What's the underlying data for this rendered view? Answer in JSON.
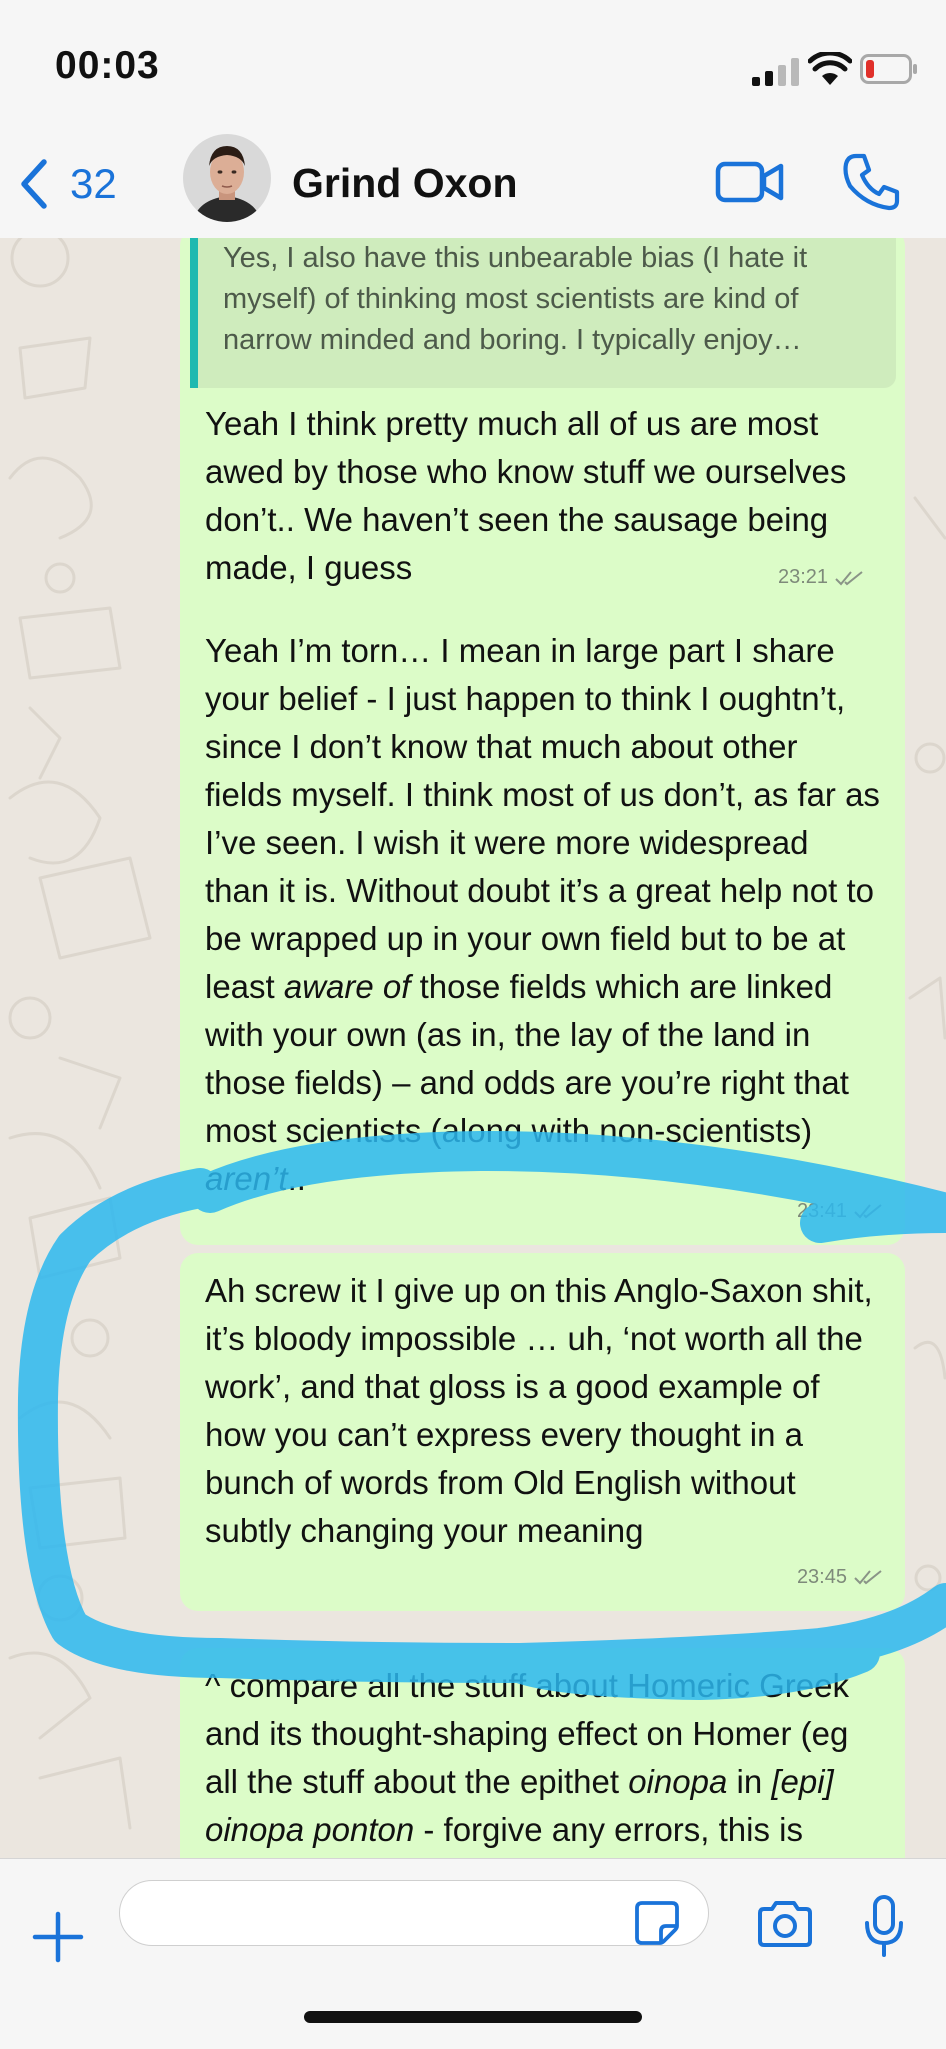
{
  "status_bar": {
    "time": "00:03"
  },
  "header": {
    "back_count": "32",
    "contact_name": "Grind Oxon"
  },
  "messages": [
    {
      "quote": "Yes, I also have this unbearable bias (I hate it myself) of thinking most scientists are kind of narrow minded and boring. I typically enjoy…",
      "text": "Yeah I think pretty much all of us are most awed by those who know stuff we ourselves don’t.. We haven’t seen the sausage being made, I guess",
      "time": "23:21"
    },
    {
      "text_before_em1": "Yeah I’m torn… I mean in large part I share your belief - I just happen to think I oughtn’t, since I don’t know that much about other fields myself. I think most of us don’t, as far as I’ve seen. I wish it were more widespread than it is. Without doubt it’s a great help not to be wrapped up in your own field but to be at least ",
      "em1": "aware of",
      "text_mid": " those fields which are linked with your own (as in, the lay of the land in those fields) – and odds are you’re right that most scientists (along with non-scientists) ",
      "em2": "aren’t",
      "text_end": "..",
      "time": "23:41"
    },
    {
      "text": "Ah screw it I give up on this Anglo-Saxon shit, it’s bloody impossible … uh, ‘not worth all the work’, and that gloss is a good example of how you can’t express every thought in a bunch of words from Old English without subtly changing your meaning",
      "time": "23:45"
    },
    {
      "text_before_em1": "^ compare all the stuff about Homeric Greek and its thought-shaping effect on Homer (eg all the stuff about the epithet ",
      "em1": "oinopa",
      "text_mid": " in ",
      "em2": "[epi] oinopa ponton",
      "text_end": " - forgive any errors, this is dimly remembered"
    }
  ],
  "colors": {
    "accent": "#1a73d9",
    "bubble": "#dcfcc8",
    "quote_bar": "#1fb9b0",
    "highlight": "#2bb7ee",
    "chat_background": "#ebe6df"
  }
}
